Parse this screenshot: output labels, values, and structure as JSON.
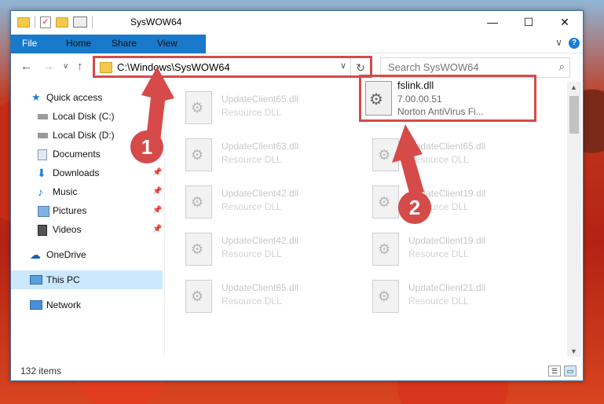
{
  "window": {
    "title": "SysWOW64",
    "controls": {
      "minimize": "—",
      "maximize": "☐",
      "close": "✕"
    }
  },
  "ribbon": {
    "tabs": [
      "File",
      "Home",
      "Share",
      "View"
    ],
    "help": "?",
    "expand": "∨"
  },
  "navigation": {
    "back": "←",
    "forward": "→",
    "recent": "∨",
    "up": "↑",
    "address": "C:\\Windows\\SysWOW64",
    "dropdown": "∨",
    "refresh": "↻",
    "search_placeholder": "Search SysWOW64",
    "search_icon": "⌕"
  },
  "sidebar": {
    "items": [
      {
        "label": "Quick access",
        "icon": "star-icon",
        "pinned": false
      },
      {
        "label": "Local Disk (C:)",
        "icon": "drive-icon",
        "pinned": false
      },
      {
        "label": "Local Disk (D:)",
        "icon": "drive-icon",
        "pinned": false
      },
      {
        "label": "Documents",
        "icon": "documents-icon",
        "pinned": true
      },
      {
        "label": "Downloads",
        "icon": "download-icon",
        "pinned": true
      },
      {
        "label": "Music",
        "icon": "music-icon",
        "pinned": true
      },
      {
        "label": "Pictures",
        "icon": "pictures-icon",
        "pinned": true
      },
      {
        "label": "Videos",
        "icon": "videos-icon",
        "pinned": true
      },
      {
        "label": "OneDrive",
        "icon": "cloud-icon",
        "pinned": false
      },
      {
        "label": "This PC",
        "icon": "computer-icon",
        "pinned": false,
        "selected": true
      },
      {
        "label": "Network",
        "icon": "network-icon",
        "pinned": false
      }
    ],
    "pin_glyph": "📌"
  },
  "files": [
    {
      "name": "UpdateClient65.dll",
      "type": "Resource DLL"
    },
    {
      "name": "UpdateClient63.dll",
      "type": "Resource DLL"
    },
    {
      "name": "UpdateClient65.dll",
      "type": "Resource DLL"
    },
    {
      "name": "UpdateClient42.dll",
      "type": "Resource DLL"
    },
    {
      "name": "UpdateClient19.dll",
      "type": "Resource DLL"
    },
    {
      "name": "UpdateClient42.dll",
      "type": "Resource DLL"
    },
    {
      "name": "UpdateClient19.dll",
      "type": "Resource DLL"
    },
    {
      "name": "UpdateClient65.dll",
      "type": "Resource DLL"
    },
    {
      "name": "UpdateClient21.dll",
      "type": "Resource DLL"
    }
  ],
  "featured_file": {
    "name": "fslink.dll",
    "version": "7.00.00.51",
    "description": "Norton AntiVirus Fi..."
  },
  "annotations": {
    "step1": "1",
    "step2": "2",
    "color": "#d64a4a"
  },
  "status": {
    "item_count": "132 items"
  }
}
